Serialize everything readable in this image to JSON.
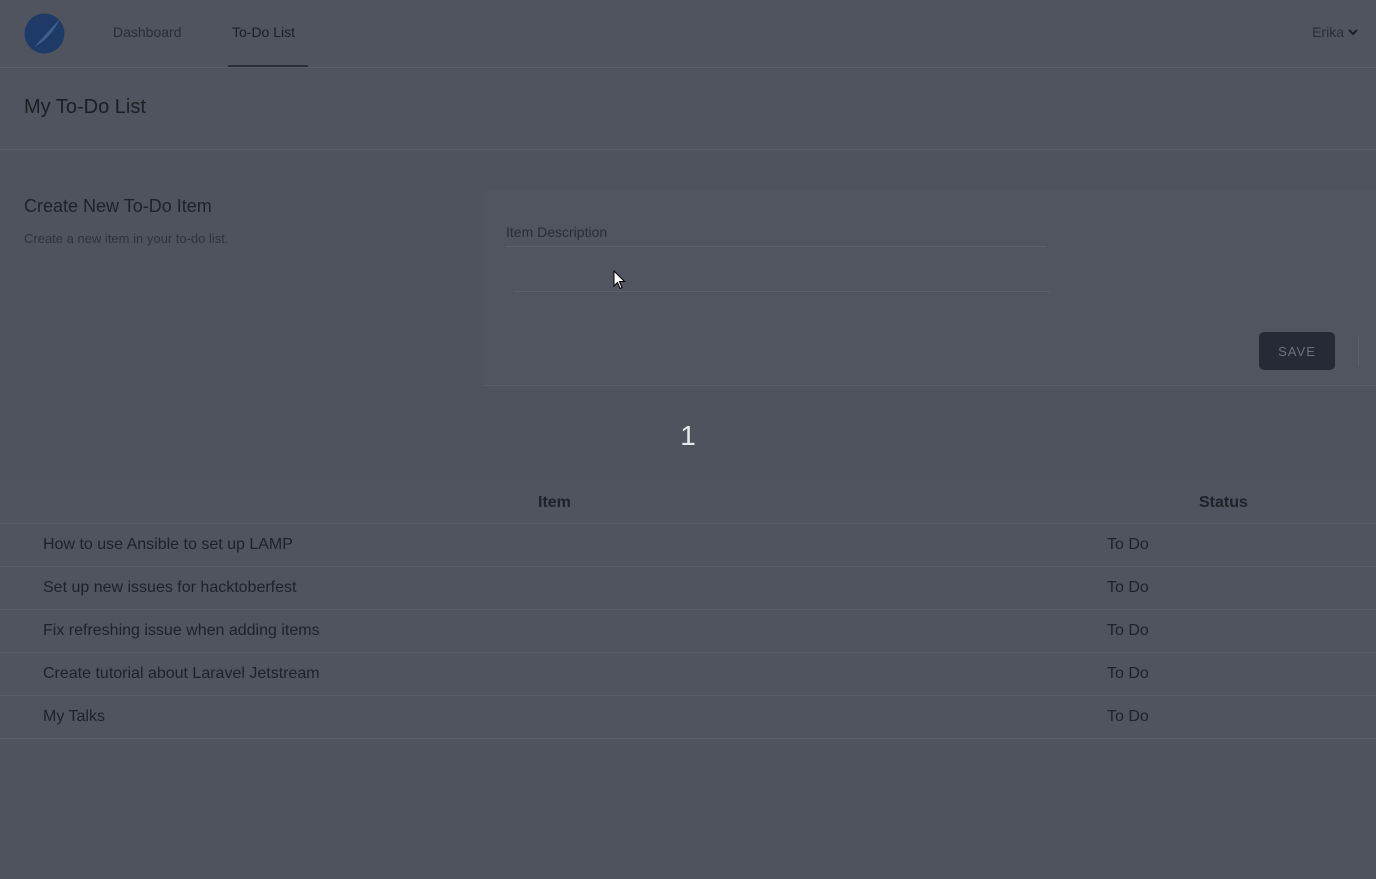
{
  "nav": {
    "links": [
      "Dashboard",
      "To-Do List"
    ],
    "user": "Erika"
  },
  "page_title": "My To-Do List",
  "form": {
    "title": "Create New To-Do Item",
    "description": "Create a new item in your to-do list.",
    "field_label": "Item Description",
    "input_value": "",
    "save_label": "SAVE"
  },
  "page_number": "1",
  "table": {
    "headers": {
      "item": "Item",
      "status": "Status"
    },
    "rows": [
      {
        "item": "How to use Ansible to set up LAMP",
        "status": "To Do"
      },
      {
        "item": "Set up new issues for hacktoberfest",
        "status": "To Do"
      },
      {
        "item": "Fix refreshing issue when adding items",
        "status": "To Do"
      },
      {
        "item": "Create tutorial about Laravel Jetstream",
        "status": "To Do"
      },
      {
        "item": "My Talks",
        "status": "To Do"
      }
    ]
  },
  "colors": {
    "overlay_bg": "#4f535e",
    "button_bg": "#262a36",
    "page_number_text": "#e8e9ec"
  }
}
